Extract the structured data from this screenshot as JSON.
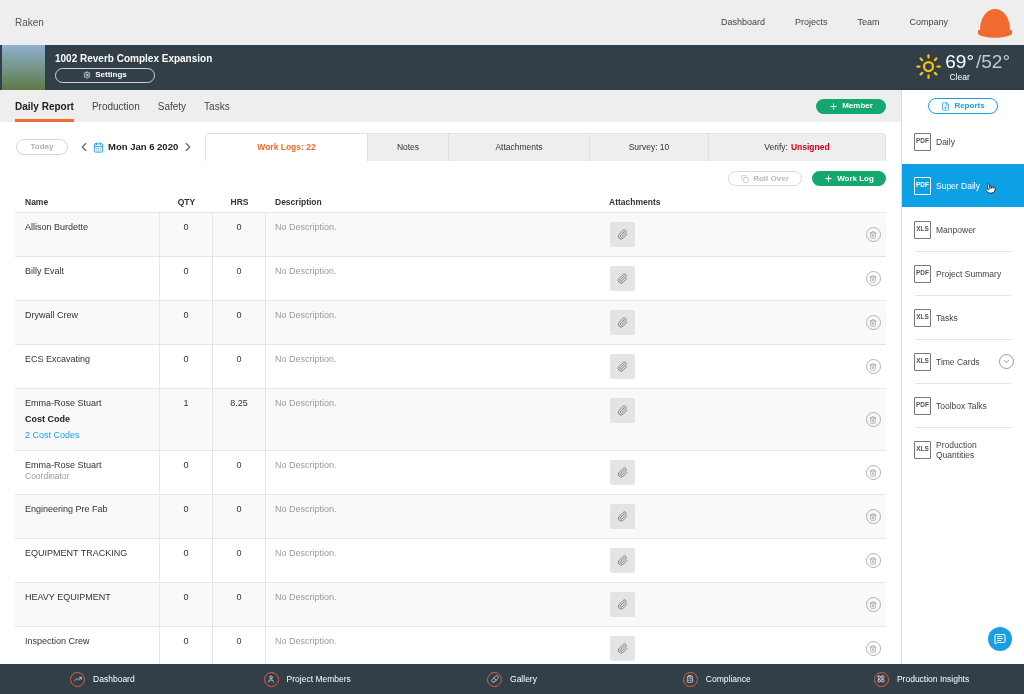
{
  "top_nav": {
    "brand": "Raken",
    "links": [
      {
        "label": "Dashboard"
      },
      {
        "label": "Projects"
      },
      {
        "label": "Team"
      },
      {
        "label": "Company"
      }
    ]
  },
  "project": {
    "title": "1002 Reverb Complex Expansion",
    "settings_button": "Settings",
    "weather": {
      "high": "69°",
      "low": "/52°",
      "condition": "Clear"
    }
  },
  "section_tabs": [
    {
      "label": "Daily Report",
      "selected": true
    },
    {
      "label": "Production",
      "selected": false
    },
    {
      "label": "Safety",
      "selected": false
    },
    {
      "label": "Tasks",
      "selected": false
    }
  ],
  "member_button": "Member",
  "date_bar": {
    "today_button": "Today",
    "date": "Mon Jan 6 2020"
  },
  "log_tabs": [
    {
      "label": "Work Logs: 22",
      "selected": true
    },
    {
      "label": "Notes",
      "selected": false
    },
    {
      "label": "Attachments",
      "selected": false
    },
    {
      "label": "Survey: 10",
      "selected": false
    },
    {
      "label": "Verify:",
      "status": "Unsigned",
      "selected": false
    }
  ],
  "log_actions": [
    {
      "label": "Roll Over",
      "kind": "copy",
      "disabled": true
    },
    {
      "label": "Work Log",
      "kind": "add",
      "disabled": false
    }
  ],
  "table": {
    "columns": [
      "Name",
      "QTY",
      "HRS",
      "Description",
      "Attachments"
    ],
    "rows": [
      {
        "name": "Allison Burdette",
        "qty": "0",
        "hrs": "0",
        "description": "No Description."
      },
      {
        "name": "Billy Evalt",
        "qty": "0",
        "hrs": "0",
        "description": "No Description."
      },
      {
        "name": "Drywall Crew",
        "qty": "0",
        "hrs": "0",
        "description": "No Description."
      },
      {
        "name": "ECS Excavating",
        "qty": "0",
        "hrs": "0",
        "description": "No Description."
      },
      {
        "name": "Emma-Rose Stuart",
        "cost_code_label": "Cost Code",
        "cost_code_link": "2 Cost Codes",
        "qty": "1",
        "hrs": "8.25",
        "description": "No Description."
      },
      {
        "name": "Emma-Rose Stuart",
        "role": "Coordinator",
        "qty": "0",
        "hrs": "0",
        "description": "No Description."
      },
      {
        "name": "Engineering Pre Fab",
        "qty": "0",
        "hrs": "0",
        "description": "No Description."
      },
      {
        "name": "EQUIPMENT TRACKING",
        "qty": "0",
        "hrs": "0",
        "description": "No Description."
      },
      {
        "name": "HEAVY EQUIPMENT",
        "qty": "0",
        "hrs": "0",
        "description": "No Description."
      },
      {
        "name": "Inspection Crew",
        "qty": "0",
        "hrs": "0",
        "description": "No Description."
      }
    ]
  },
  "reports": {
    "button": "Reports",
    "items": [
      {
        "label": "Daily",
        "file_type": "PDF",
        "selected": false,
        "expandable": false
      },
      {
        "label": "Super Daily",
        "file_type": "PDF",
        "selected": true,
        "expandable": false
      },
      {
        "label": "Manpower",
        "file_type": "XLS",
        "selected": false,
        "expandable": false
      },
      {
        "label": "Project Summary",
        "file_type": "PDF",
        "selected": false,
        "expandable": false
      },
      {
        "label": "Tasks",
        "file_type": "XLS",
        "selected": false,
        "expandable": false
      },
      {
        "label": "Time Cards",
        "file_type": "XLS",
        "selected": false,
        "expandable": true
      },
      {
        "label": "Toolbox Talks",
        "file_type": "PDF",
        "selected": false,
        "expandable": false
      },
      {
        "label": "Production Quantities",
        "file_type": "XLS",
        "selected": false,
        "expandable": false
      }
    ]
  },
  "bottom_nav": [
    {
      "label": "Dashboard",
      "kind": "chart"
    },
    {
      "label": "Project Members",
      "kind": "members"
    },
    {
      "label": "Gallery",
      "kind": "gallery"
    },
    {
      "label": "Compliance",
      "kind": "compliance"
    },
    {
      "label": "Production Insights",
      "kind": "insights"
    }
  ]
}
